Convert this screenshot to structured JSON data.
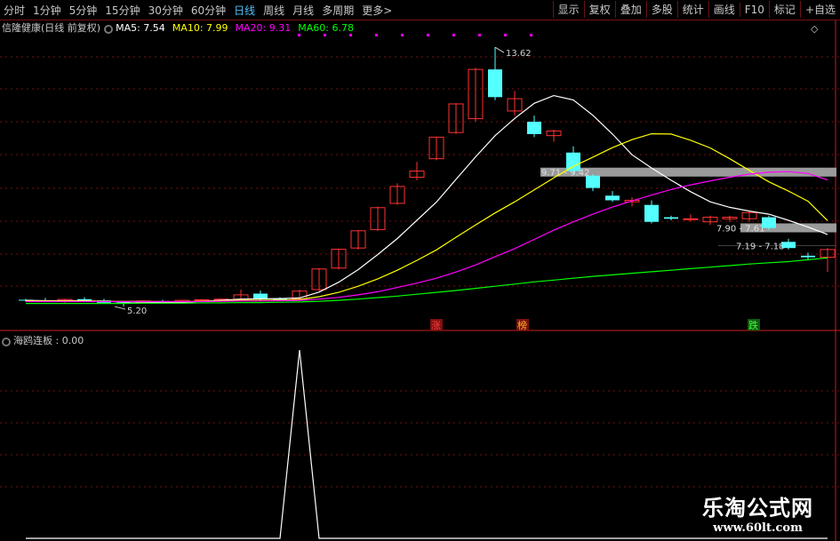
{
  "toolbar": {
    "periods": [
      "分时",
      "1分钟",
      "5分钟",
      "15分钟",
      "30分钟",
      "60分钟",
      "日线",
      "周线",
      "月线",
      "多周期",
      "更多>"
    ],
    "active_period": "日线",
    "right_buttons": [
      "显示",
      "复权",
      "叠加",
      "多股",
      "统计",
      "画线",
      "F10",
      "标记",
      "+自选"
    ]
  },
  "main": {
    "stock_title": "信隆健康(日线 前复权)",
    "ma": [
      {
        "label": "MA5: 7.54",
        "color": "#ffffff"
      },
      {
        "label": "MA10: 7.99",
        "color": "#ffff00"
      },
      {
        "label": "MA20: 9.31",
        "color": "#ff00ff"
      },
      {
        "label": "MA60: 6.78",
        "color": "#00ff00"
      }
    ],
    "markers": {
      "up": "涨",
      "list": "榜",
      "down": "跌"
    },
    "price_labels": {
      "high": "13.62",
      "low": "5.20"
    },
    "zones": [
      "9.71 - 9.42",
      "7.90 - 7.61",
      "7.19 - 7.18"
    ],
    "diamond": "◇"
  },
  "indicator": {
    "title": "海鸥连板 : 0.00"
  },
  "watermark": {
    "line1": "乐淘公式网",
    "line2": "www.60lt.com"
  },
  "colors": {
    "up": "#ff3232",
    "down": "#54ffff",
    "ma5": "#ffffff",
    "ma10": "#ffff00",
    "ma20": "#ff00ff",
    "ma60": "#00ff00",
    "grid": "#7a1010"
  },
  "chart_data": [
    {
      "type": "candlestick",
      "title": "信隆健康(日线 前复权)",
      "ylim": [
        5.0,
        14.0
      ],
      "candles": [
        {
          "o": 5.42,
          "h": 5.45,
          "l": 5.35,
          "c": 5.4
        },
        {
          "o": 5.4,
          "h": 5.48,
          "l": 5.35,
          "c": 5.36
        },
        {
          "o": 5.37,
          "h": 5.45,
          "l": 5.32,
          "c": 5.43
        },
        {
          "o": 5.44,
          "h": 5.5,
          "l": 5.38,
          "c": 5.4
        },
        {
          "o": 5.4,
          "h": 5.45,
          "l": 5.3,
          "c": 5.32
        },
        {
          "o": 5.33,
          "h": 5.36,
          "l": 5.2,
          "c": 5.3
        },
        {
          "o": 5.32,
          "h": 5.4,
          "l": 5.3,
          "c": 5.38
        },
        {
          "o": 5.38,
          "h": 5.42,
          "l": 5.34,
          "c": 5.36
        },
        {
          "o": 5.36,
          "h": 5.42,
          "l": 5.34,
          "c": 5.4
        },
        {
          "o": 5.4,
          "h": 5.44,
          "l": 5.38,
          "c": 5.42
        },
        {
          "o": 5.42,
          "h": 5.46,
          "l": 5.38,
          "c": 5.44
        },
        {
          "o": 5.44,
          "h": 5.75,
          "l": 5.4,
          "c": 5.58
        },
        {
          "o": 5.62,
          "h": 5.72,
          "l": 5.4,
          "c": 5.44
        },
        {
          "o": 5.45,
          "h": 5.5,
          "l": 5.38,
          "c": 5.42
        },
        {
          "o": 5.45,
          "h": 5.75,
          "l": 5.4,
          "c": 5.7
        },
        {
          "o": 5.75,
          "h": 6.45,
          "l": 5.7,
          "c": 6.42
        },
        {
          "o": 6.45,
          "h": 7.08,
          "l": 6.4,
          "c": 7.06
        },
        {
          "o": 7.1,
          "h": 7.68,
          "l": 7.05,
          "c": 7.66
        },
        {
          "o": 7.7,
          "h": 8.45,
          "l": 7.65,
          "c": 8.41
        },
        {
          "o": 8.55,
          "h": 9.2,
          "l": 8.5,
          "c": 9.1
        },
        {
          "o": 9.4,
          "h": 9.9,
          "l": 9.3,
          "c": 9.6
        },
        {
          "o": 10.0,
          "h": 10.72,
          "l": 9.95,
          "c": 10.7
        },
        {
          "o": 10.85,
          "h": 11.8,
          "l": 10.8,
          "c": 11.78
        },
        {
          "o": 11.3,
          "h": 12.95,
          "l": 11.2,
          "c": 12.9
        },
        {
          "o": 12.9,
          "h": 13.62,
          "l": 11.9,
          "c": 12.0
        },
        {
          "o": 11.55,
          "h": 12.2,
          "l": 11.4,
          "c": 11.95
        },
        {
          "o": 11.2,
          "h": 11.4,
          "l": 10.7,
          "c": 10.8
        },
        {
          "o": 10.75,
          "h": 10.95,
          "l": 10.55,
          "c": 10.9
        },
        {
          "o": 10.2,
          "h": 10.4,
          "l": 9.5,
          "c": 9.6
        },
        {
          "o": 9.45,
          "h": 9.5,
          "l": 8.95,
          "c": 9.05
        },
        {
          "o": 8.8,
          "h": 8.95,
          "l": 8.6,
          "c": 8.65
        },
        {
          "o": 8.6,
          "h": 8.75,
          "l": 8.45,
          "c": 8.65
        },
        {
          "o": 8.5,
          "h": 8.65,
          "l": 7.9,
          "c": 7.95
        },
        {
          "o": 8.1,
          "h": 8.15,
          "l": 8.0,
          "c": 8.05
        },
        {
          "o": 8.05,
          "h": 8.2,
          "l": 7.95,
          "c": 8.05
        },
        {
          "o": 7.95,
          "h": 8.15,
          "l": 7.85,
          "c": 8.1
        },
        {
          "o": 8.05,
          "h": 8.15,
          "l": 7.95,
          "c": 8.1
        },
        {
          "o": 8.05,
          "h": 8.28,
          "l": 7.95,
          "c": 8.25
        },
        {
          "o": 8.1,
          "h": 8.15,
          "l": 7.68,
          "c": 7.75
        },
        {
          "o": 7.3,
          "h": 7.4,
          "l": 7.05,
          "c": 7.1
        },
        {
          "o": 6.85,
          "h": 6.95,
          "l": 6.7,
          "c": 6.8
        },
        {
          "o": 6.8,
          "h": 7.1,
          "l": 6.32,
          "c": 7.05
        }
      ],
      "series": [
        {
          "name": "MA5",
          "values": [
            5.4,
            5.39,
            5.39,
            5.39,
            5.37,
            5.35,
            5.34,
            5.33,
            5.33,
            5.37,
            5.4,
            5.44,
            5.45,
            5.46,
            5.48,
            5.67,
            5.99,
            6.4,
            6.89,
            7.41,
            8.0,
            8.59,
            9.33,
            10.06,
            10.75,
            11.31,
            11.8,
            12.05,
            11.91,
            11.41,
            10.8,
            10.13,
            9.7,
            9.3,
            8.93,
            8.6,
            8.42,
            8.3,
            8.2,
            8.0,
            7.78,
            7.54
          ]
        },
        {
          "name": "MA10",
          "values": [
            5.38,
            5.38,
            5.38,
            5.38,
            5.37,
            5.37,
            5.37,
            5.36,
            5.36,
            5.37,
            5.38,
            5.4,
            5.4,
            5.41,
            5.43,
            5.52,
            5.66,
            5.86,
            6.1,
            6.38,
            6.7,
            7.04,
            7.45,
            7.85,
            8.24,
            8.6,
            8.99,
            9.38,
            9.75,
            10.05,
            10.36,
            10.62,
            10.81,
            10.8,
            10.6,
            10.35,
            10.0,
            9.62,
            9.25,
            8.95,
            8.62,
            7.99
          ]
        },
        {
          "name": "MA20",
          "values": [
            5.36,
            5.36,
            5.36,
            5.36,
            5.36,
            5.36,
            5.36,
            5.36,
            5.36,
            5.36,
            5.37,
            5.38,
            5.38,
            5.39,
            5.4,
            5.44,
            5.5,
            5.58,
            5.68,
            5.82,
            5.96,
            6.12,
            6.32,
            6.55,
            6.82,
            7.08,
            7.38,
            7.68,
            7.95,
            8.2,
            8.43,
            8.63,
            8.82,
            9.0,
            9.15,
            9.28,
            9.4,
            9.5,
            9.56,
            9.58,
            9.52,
            9.31
          ]
        },
        {
          "name": "MA60",
          "values": [
            5.3,
            5.3,
            5.3,
            5.3,
            5.3,
            5.3,
            5.31,
            5.31,
            5.31,
            5.32,
            5.32,
            5.33,
            5.33,
            5.34,
            5.35,
            5.37,
            5.4,
            5.44,
            5.49,
            5.54,
            5.6,
            5.66,
            5.72,
            5.79,
            5.86,
            5.93,
            6.0,
            6.06,
            6.12,
            6.18,
            6.23,
            6.28,
            6.33,
            6.38,
            6.43,
            6.48,
            6.53,
            6.58,
            6.62,
            6.66,
            6.72,
            6.78
          ]
        }
      ]
    },
    {
      "type": "line",
      "title": "海鸥连板 : 0.00",
      "ylim": [
        0,
        1
      ],
      "series": [
        {
          "name": "海鸥连板",
          "values": [
            0,
            0,
            0,
            0,
            0,
            0,
            0,
            0,
            0,
            0,
            0,
            0,
            0,
            0,
            0,
            0,
            0,
            0,
            0,
            0,
            0,
            0,
            0,
            0,
            0,
            0,
            0,
            0,
            0,
            0,
            0,
            0,
            0,
            0,
            0,
            0,
            0,
            0,
            0,
            0,
            0,
            0
          ]
        }
      ],
      "peak": {
        "index": 14,
        "value": 1
      }
    }
  ]
}
